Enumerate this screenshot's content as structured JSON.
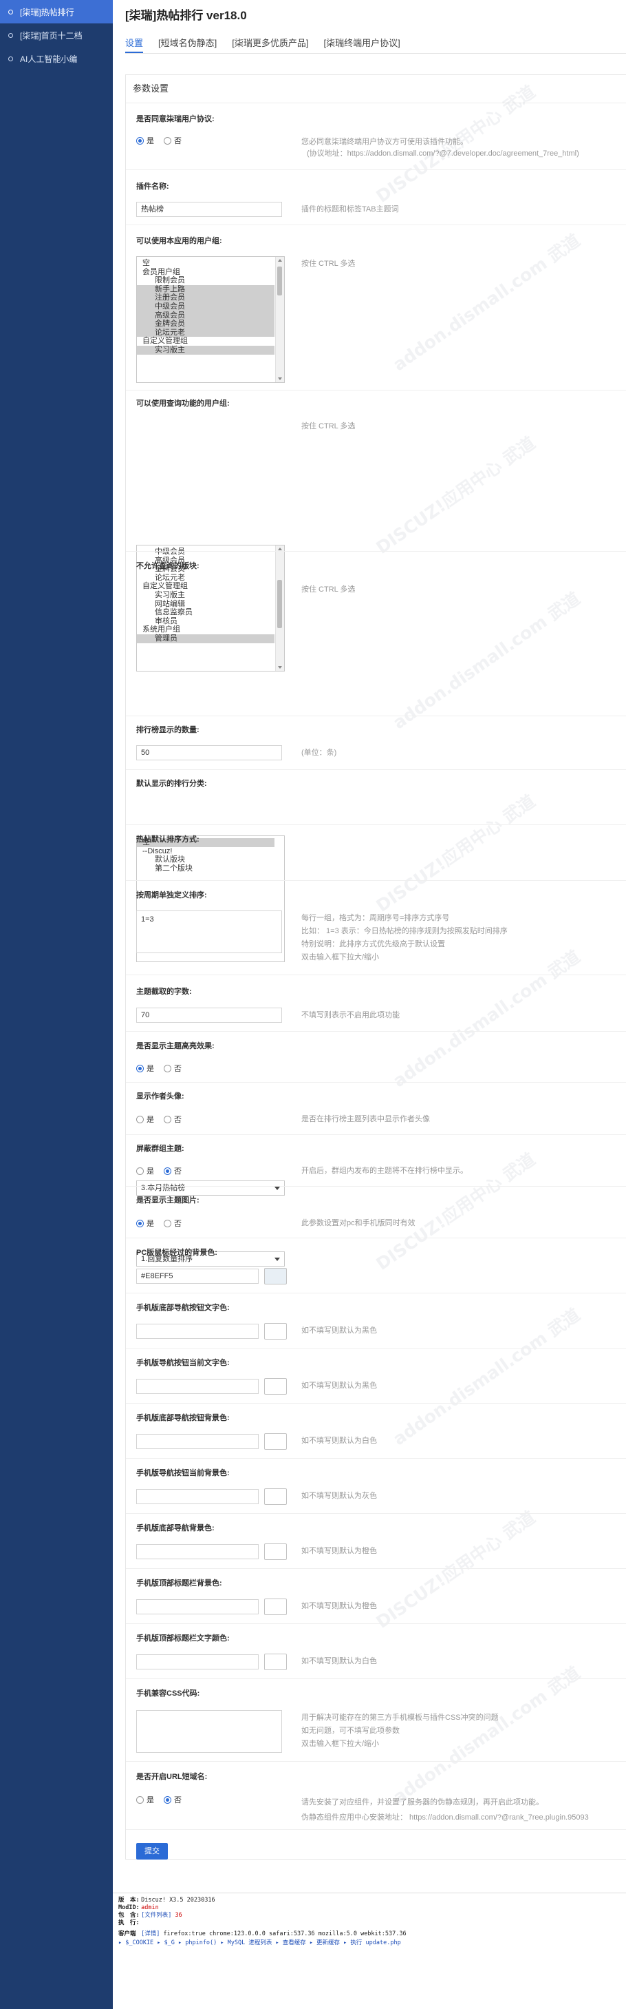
{
  "sidebar": {
    "items": [
      {
        "label": "[柒瑞]热帖排行",
        "active": true
      },
      {
        "label": "[柒瑞]首页十二档",
        "active": false
      },
      {
        "label": "AI人工智能小编",
        "active": false
      }
    ]
  },
  "page": {
    "title": "[柒瑞]热帖排行 ver18.0"
  },
  "tabs": [
    "设置",
    "[短域名伪静态]",
    "[柒瑞更多优质产品]",
    "[柒瑞终端用户协议]"
  ],
  "panel": {
    "title": "参数设置"
  },
  "radio_labels": {
    "yes": "是",
    "no": "否"
  },
  "fields": {
    "agreement": {
      "label": "是否同意柒瑞用户协议:",
      "value": "yes",
      "desc1": "您必同意柒瑞终端用户协议方可使用该插件功能。",
      "desc2": "(协议地址：https://addon.dismall.com/?@7.developer.doc/agreement_7ree_html)"
    },
    "plugin_name": {
      "label": "插件名称:",
      "value": "热帖榜",
      "desc": "插件的标题和标签TAB主题词"
    },
    "allowed_groups": {
      "label": "可以使用本应用的用户组:",
      "desc": "按住 CTRL 多选",
      "options": [
        {
          "text": "空",
          "level": 0,
          "selected": false
        },
        {
          "text": "会员用户组",
          "level": 0,
          "selected": false
        },
        {
          "text": "限制会员",
          "level": 1,
          "selected": false
        },
        {
          "text": "新手上路",
          "level": 1,
          "selected": true
        },
        {
          "text": "注册会员",
          "level": 1,
          "selected": true
        },
        {
          "text": "中级会员",
          "level": 1,
          "selected": true
        },
        {
          "text": "高级会员",
          "level": 1,
          "selected": true
        },
        {
          "text": "金牌会员",
          "level": 1,
          "selected": true
        },
        {
          "text": "论坛元老",
          "level": 1,
          "selected": true
        },
        {
          "text": "自定义管理组",
          "level": 0,
          "selected": false
        },
        {
          "text": "实习版主",
          "level": 1,
          "selected": true
        }
      ]
    },
    "query_groups": {
      "label": "可以使用查询功能的用户组:",
      "desc": "按住 CTRL 多选",
      "options": [
        {
          "text": "中级会员",
          "level": 1,
          "selected": false
        },
        {
          "text": "高级会员",
          "level": 1,
          "selected": false
        },
        {
          "text": "金牌会员",
          "level": 1,
          "selected": false
        },
        {
          "text": "论坛元老",
          "level": 1,
          "selected": false
        },
        {
          "text": "自定义管理组",
          "level": 0,
          "selected": false
        },
        {
          "text": "实习版主",
          "level": 1,
          "selected": false
        },
        {
          "text": "网站编辑",
          "level": 1,
          "selected": false
        },
        {
          "text": "信息监察员",
          "level": 1,
          "selected": false
        },
        {
          "text": "审核员",
          "level": 1,
          "selected": false
        },
        {
          "text": "系统用户组",
          "level": 0,
          "selected": false
        },
        {
          "text": "管理员",
          "level": 1,
          "selected": true
        }
      ]
    },
    "forbidden_forums": {
      "label": "不允许查询的版块:",
      "desc": "按住 CTRL 多选",
      "options": [
        {
          "text": "空",
          "level": 0,
          "selected": true
        },
        {
          "text": "--Discuz!",
          "level": 0,
          "selected": false
        },
        {
          "text": "默认版块",
          "level": 2,
          "selected": false
        },
        {
          "text": "第二个版块",
          "level": 2,
          "selected": false
        }
      ]
    },
    "rank_count": {
      "label": "排行榜显示的数量:",
      "value": "50",
      "desc": "(单位：条)"
    },
    "default_category": {
      "label": "默认显示的排行分类:",
      "value": "3.本月热帖榜"
    },
    "default_sort": {
      "label": "热帖默认排序方式:",
      "value": "1.回复数量排序"
    },
    "period_sort": {
      "label": "按周期单独定义排序:",
      "value": "1=3",
      "desc1": "每行一组，格式为：周期序号=排序方式序号",
      "desc2": "比如：  1=3 表示：今日热帖榜的排序规则为按照发贴时间排序",
      "desc3": "特别说明：此排序方式优先级高于默认设置",
      "desc4": "双击输入框下拉大/缩小"
    },
    "subject_length": {
      "label": "主题截取的字数:",
      "value": "70",
      "desc": "不填写则表示不启用此项功能"
    },
    "highlight": {
      "label": "是否显示主题高亮效果:",
      "value": "yes"
    },
    "show_avatar": {
      "label": "显示作者头像:",
      "value": "no",
      "desc": "是否在排行榜主题列表中显示作者头像"
    },
    "hide_group_threads": {
      "label": "屏蔽群组主题:",
      "value": "no",
      "desc": "开启后，群组内发布的主题将不在排行榜中显示。"
    },
    "show_images": {
      "label": "是否显示主题图片:",
      "value": "yes",
      "desc": "此参数设置对pc和手机版同时有效"
    },
    "pc_hover_bg": {
      "label": "PC版鼠标经过的背景色:",
      "value": "#E8EFF5",
      "swatch": "#E8EFF5"
    },
    "m_nav_text": {
      "label": "手机版底部导航按钮文字色:",
      "value": "",
      "desc": "如不填写则默认为黑色"
    },
    "m_nav_current_text": {
      "label": "手机版导航按钮当前文字色:",
      "value": "",
      "desc": "如不填写则默认为黑色"
    },
    "m_nav_btn_bg": {
      "label": "手机版底部导航按钮背景色:",
      "value": "",
      "desc": "如不填写则默认为白色"
    },
    "m_nav_current_bg": {
      "label": "手机版导航按钮当前背景色:",
      "value": "",
      "desc": "如不填写则默认为灰色"
    },
    "m_nav_bar_bg": {
      "label": "手机版底部导航背景色:",
      "value": "",
      "desc": "如不填写则默认为橙色"
    },
    "m_title_bar_bg": {
      "label": "手机版顶部标题栏背景色:",
      "value": "",
      "desc": "如不填写则默认为橙色"
    },
    "m_title_bar_text": {
      "label": "手机版顶部标题栏文字颜色:",
      "value": "",
      "desc": "如不填写则默认为白色"
    },
    "m_css": {
      "label": "手机兼容CSS代码:",
      "value": "",
      "desc1": "用于解决可能存在的第三方手机模板与插件CSS冲突的问题",
      "desc2": "如无问题，可不填写此项参数",
      "desc3": "双击输入框下拉大/缩小"
    },
    "short_url": {
      "label": "是否开启URL短域名:",
      "value": "yes",
      "desc1": "请先安装了对应组件，并设置了服务器的伪静态规则，再开启此项功能。",
      "desc2": "伪静态组件应用中心安装地址：  https://addon.dismall.com/?@rank_7ree.plugin.95093"
    }
  },
  "submit_label": "提交",
  "watermark": {
    "text1": "DISCUZ!应用中心",
    "text2": "addon.dismall.com",
    "text3": "武道"
  },
  "debug": {
    "version_label": "版　本:",
    "version": "Discuz! X3.5 20230316",
    "modid_label": "ModID:",
    "modid": "admin",
    "include_label": "包　含:",
    "include_link": "[文件列表]",
    "include_count": "36",
    "exec_label": "执　行:",
    "client_label": "客户端",
    "client_link": "[详情]",
    "client_info": "firefox:true chrome:123.0.0.0 safari:537.36 mozilla:5.0 webkit:537.36",
    "links": "▸ $_COOKIE ▸ $_G ▸ phpinfo() ▸ MySQL 进程列表 ▸ 查看缓存 ▸ 更新缓存 ▸ 执行 update.php"
  }
}
